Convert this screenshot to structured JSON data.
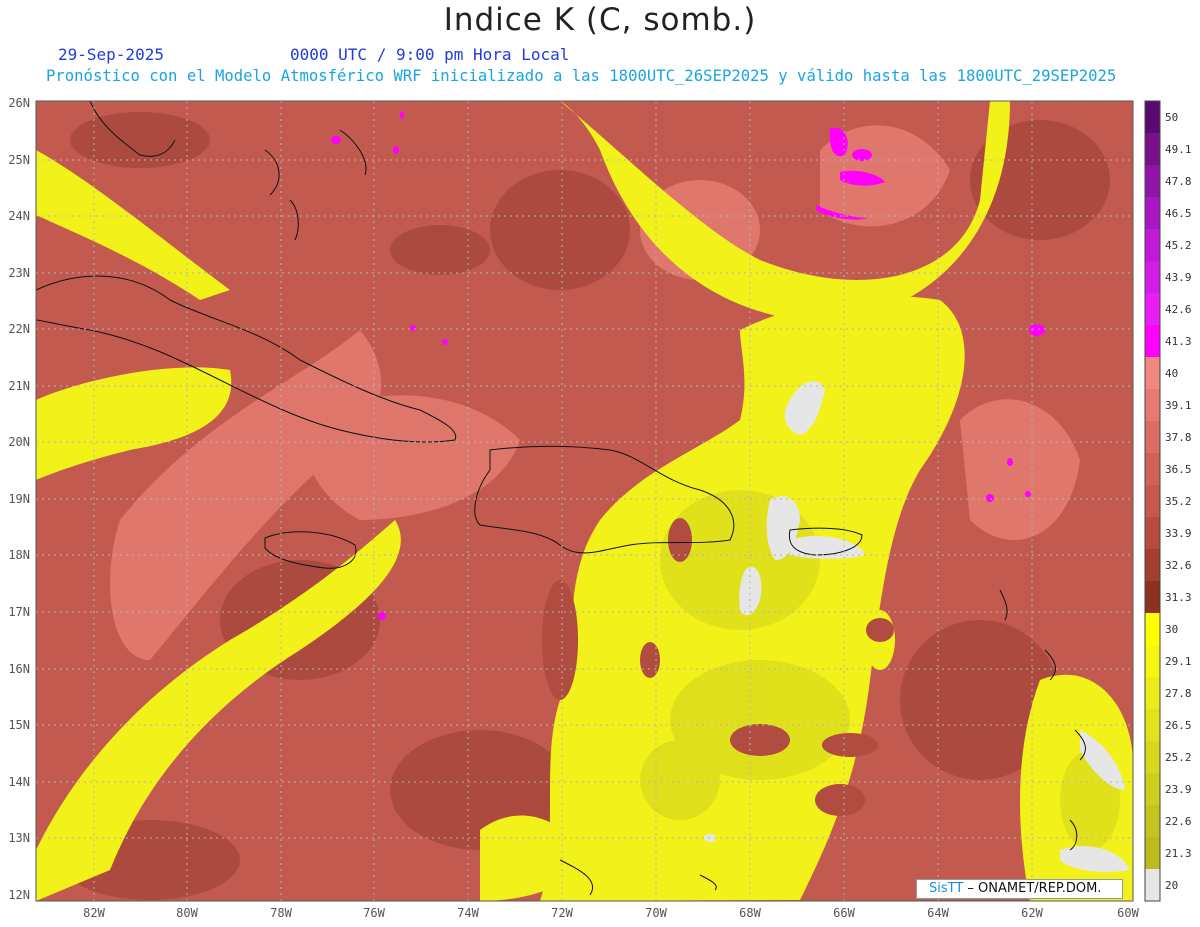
{
  "title": "Indice K (C, somb.)",
  "date_label": "29-Sep-2025",
  "utc_label": "0000 UTC / 9:00 pm Hora Local",
  "model_label": "Pronóstico con el Modelo Atmosférico WRF inicializado a las 1800UTC_26SEP2025 y válido hasta las  1800UTC_29SEP2025",
  "credit": {
    "brand": "SisTT",
    "org": " – ONAMET/REP.DOM."
  },
  "map": {
    "lat_labels": [
      "26N",
      "25N",
      "24N",
      "23N",
      "22N",
      "21N",
      "20N",
      "19N",
      "18N",
      "17N",
      "16N",
      "15N",
      "14N",
      "13N",
      "12N"
    ],
    "lon_labels": [
      "82W",
      "80W",
      "78W",
      "76W",
      "74W",
      "72W",
      "70W",
      "68W",
      "66W",
      "64W",
      "62W",
      "60W"
    ],
    "colors": {
      "base": "#c25a50",
      "yellow": "#f2f21a",
      "olive": "#d4d418",
      "salmon": "#e88078",
      "brown": "#8c3c20",
      "white": "#e6e6e6",
      "magenta": "#ff00ff",
      "grid": "#b4b4b4"
    }
  },
  "colorbar": {
    "labels": [
      "50",
      "49.1",
      "47.8",
      "46.5",
      "45.2",
      "43.9",
      "42.6",
      "41.3",
      "40",
      "39.1",
      "37.8",
      "36.5",
      "35.2",
      "33.9",
      "32.6",
      "31.3",
      "30",
      "29.1",
      "27.8",
      "26.5",
      "25.2",
      "23.9",
      "22.6",
      "21.3",
      "20"
    ],
    "colors": [
      "#5a0a6e",
      "#78108a",
      "#9014a8",
      "#a818c2",
      "#c01ad8",
      "#d41ce8",
      "#e81ef4",
      "#ff00ff",
      "#f08880",
      "#e67a72",
      "#dc6c64",
      "#d26258",
      "#c8584e",
      "#b84a3e",
      "#a43e30",
      "#8c3220",
      "#ffff00",
      "#f6f610",
      "#ecec18",
      "#e2e21a",
      "#d8d81c",
      "#cece1e",
      "#c4c41e",
      "#bcbc1e",
      "#e6e6e6"
    ]
  }
}
